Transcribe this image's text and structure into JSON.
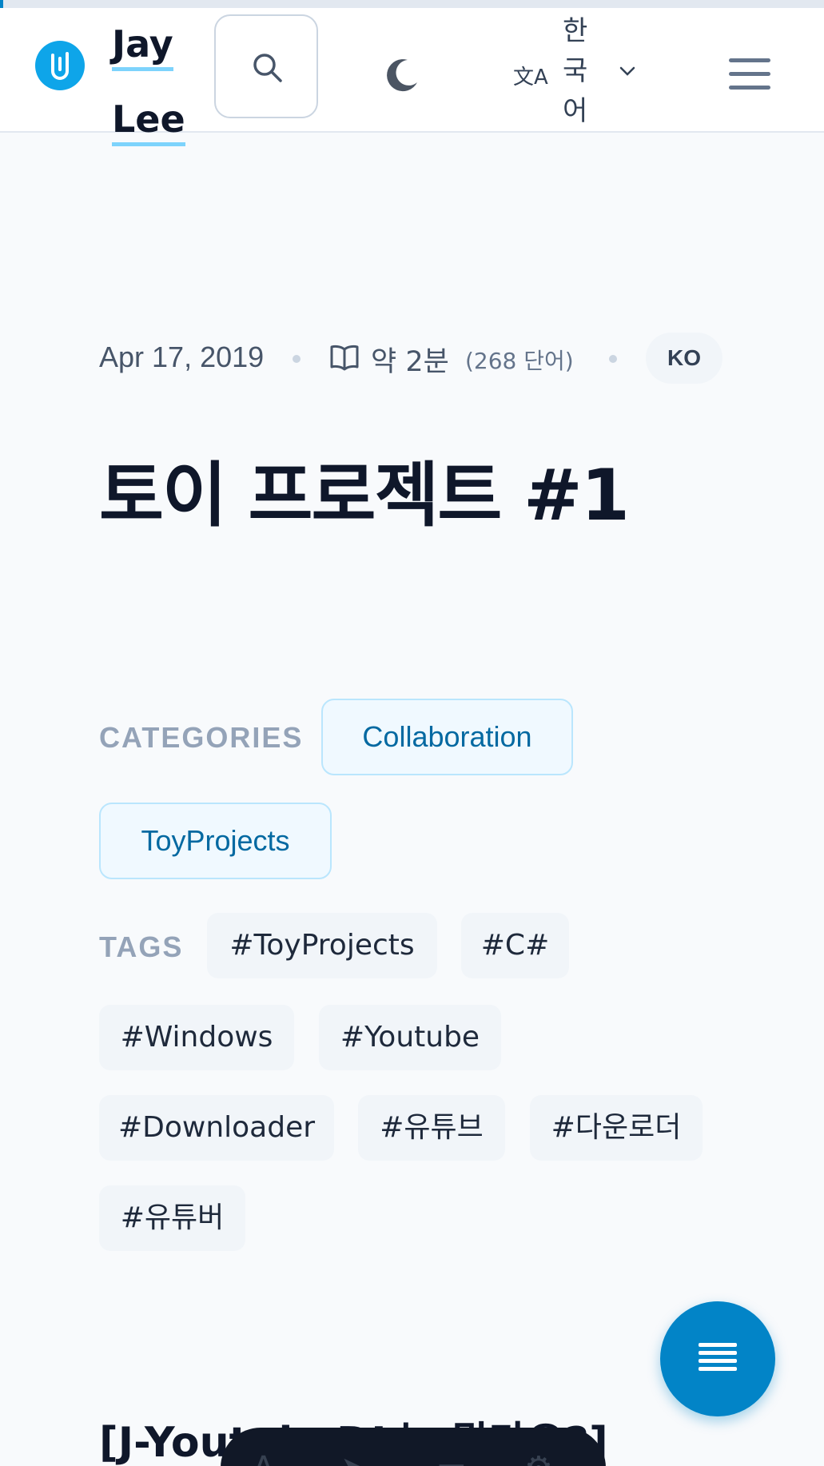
{
  "reading_progress": 0.004,
  "colors": {
    "accent": "#0284c7",
    "brand_underline": "#7dd3fc",
    "category_border": "#bae6fd",
    "category_bg": "#f0f9ff",
    "category_text": "#0369a1",
    "tag_bg": "#f1f5f9"
  },
  "header": {
    "logo_icon": "paperclip-logo-icon",
    "brand_line1": "Jay",
    "brand_line2": "Lee",
    "search_icon": "search-icon",
    "theme_icon": "moon-icon",
    "lang_icon": "translate-icon",
    "lang_icon_glyph": "文A",
    "language": "한국어",
    "menu_icon": "hamburger-menu-icon"
  },
  "meta": {
    "date": "Apr 17, 2019",
    "read_icon": "book-open-icon",
    "read_time": "약 2분",
    "word_count": "(268 단어)",
    "lang_badge": "KO"
  },
  "post": {
    "title": "토이 프로젝트 #1",
    "categories_label": "CATEGORIES",
    "categories": [
      "Collaboration",
      "ToyProjects"
    ],
    "tags_label": "TAGS",
    "tags": [
      "#ToyProjects",
      "#C#",
      "#Windows",
      "#Youtube",
      "#Downloader",
      "#유튜브",
      "#다운로더",
      "#유튜버"
    ],
    "section_heading": "[J-YoutubeDL는 뭔가요?]"
  },
  "fab": {
    "icon": "table-of-contents-icon"
  }
}
